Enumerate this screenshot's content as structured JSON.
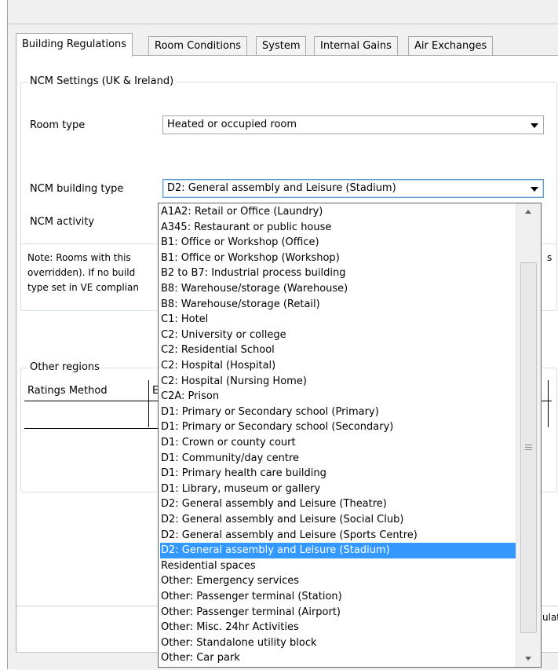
{
  "tabs": [
    {
      "label": "Building Regulations"
    },
    {
      "label": "Room Conditions"
    },
    {
      "label": "System"
    },
    {
      "label": "Internal Gains"
    },
    {
      "label": "Air Exchanges"
    }
  ],
  "ncm_group": {
    "legend": "NCM Settings (UK & Ireland)",
    "room_type_label": "Room type",
    "room_type_value": "Heated or occupied room",
    "building_type_label": "NCM building type",
    "building_type_value": "D2: General assembly and Leisure (Stadium)",
    "activity_label": "NCM activity"
  },
  "note": {
    "line1": "Note: Rooms with this",
    "line2": "overridden). If no build",
    "line3": "type set in VE complian",
    "right_fragment": "s"
  },
  "other_regions": {
    "legend": "Other regions",
    "col1": "Ratings Method",
    "col2_fragment": "E"
  },
  "bottom_fragment": "ulat",
  "dropdown": {
    "items": [
      "A1A2: Retail or Office (Laundry)",
      "A345: Restaurant or public house",
      "B1: Office or Workshop (Office)",
      "B1: Office or Workshop (Workshop)",
      "B2 to B7: Industrial process building",
      "B8: Warehouse/storage (Warehouse)",
      "B8: Warehouse/storage (Retail)",
      "C1: Hotel",
      "C2: University or college",
      "C2: Residential School",
      "C2: Hospital (Hospital)",
      "C2: Hospital (Nursing Home)",
      "C2A: Prison",
      "D1: Primary or Secondary school (Primary)",
      "D1: Primary or Secondary school (Secondary)",
      "D1: Crown or county court",
      "D1: Community/day centre",
      "D1: Primary health care building",
      "D1: Library, museum or gallery",
      "D2: General assembly and Leisure (Theatre)",
      "D2: General assembly and Leisure (Social Club)",
      "D2: General assembly and Leisure (Sports Centre)",
      "D2: General assembly and Leisure (Stadium)",
      "Residential spaces",
      "Other: Emergency services",
      "Other: Passenger terminal (Station)",
      "Other: Passenger terminal (Airport)",
      "Other: Misc. 24hr Activities",
      "Other: Standalone utility block",
      "Other: Car park"
    ],
    "selected_index": 22
  },
  "colors": {
    "selection": "#3399ff",
    "focus_border": "#5b9bd5",
    "group_border": "#d5dfe5"
  }
}
